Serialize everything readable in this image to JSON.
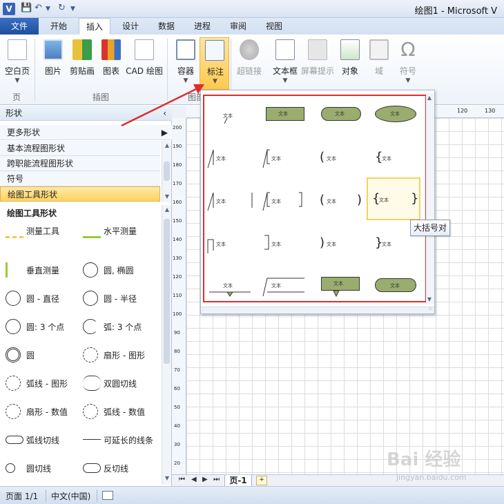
{
  "window": {
    "title": "绘图1 - Microsoft V",
    "app_icon": "V"
  },
  "tabs": [
    "文件",
    "开始",
    "插入",
    "设计",
    "数据",
    "进程",
    "审阅",
    "视图"
  ],
  "active_tab_index": 2,
  "ribbon": {
    "buttons": [
      "空白页",
      "图片",
      "剪贴画",
      "图表",
      "CAD 绘图",
      "容器",
      "标注",
      "超链接",
      "文本框",
      "屏幕提示",
      "对象",
      "域",
      "符号"
    ],
    "groups": [
      "页",
      "插图",
      "图部"
    ],
    "highlighted_button": "标注"
  },
  "shapes_panel": {
    "title": "形状",
    "more_shapes": "更多形状",
    "stencils": [
      "基本流程图形状",
      "跨职能流程图形状",
      "符号",
      "绘图工具形状"
    ],
    "active_stencil": "绘图工具形状",
    "section_title": "绘图工具形状",
    "shapes": [
      "测量工具",
      "水平测量",
      "垂直测量",
      "圆, 椭圆",
      "圆 - 直径",
      "圆 - 半径",
      "圆: 3 个点",
      "弧: 3 个点",
      "圆",
      "扇形 - 图形",
      "弧线 - 图形",
      "双圆切线",
      "扇形 - 数值",
      "弧线 - 数值",
      "弧线切线",
      "可延长的线条",
      "圆切线",
      "反切线"
    ]
  },
  "ruler": {
    "marks": [
      "120",
      "130"
    ],
    "vertical_marks": [
      "200",
      "190",
      "180",
      "170",
      "160",
      "150",
      "140",
      "130",
      "120",
      "110",
      "100",
      "90",
      "80",
      "70",
      "60",
      "50",
      "40",
      "30",
      "20"
    ]
  },
  "page_tabs": {
    "current": "页-1"
  },
  "gallery": {
    "callout_text": "文本",
    "tooltip": "大括号对"
  },
  "status_bar": {
    "page": "页面 1/1",
    "language": "中文(中国)"
  },
  "watermark": {
    "logo": "Bai 经验",
    "url": "jingyan.baidu.com"
  },
  "colors": {
    "accent_red": "#e12b2b",
    "highlight": "#ffd35f",
    "callout_fill": "#9aad6f",
    "file_tab": "#2b5cad"
  }
}
